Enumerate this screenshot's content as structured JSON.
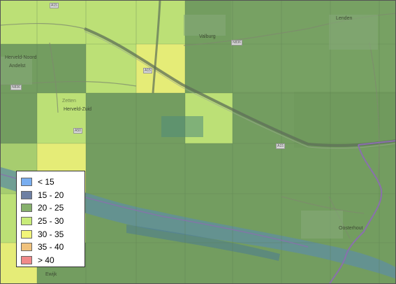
{
  "colors": {
    "base": "#6f9a5c",
    "cell_25_30": "#c9ec7a",
    "cell_30_35": "#f2f57a",
    "river": "#5f8fa0",
    "border": "#8a6fae"
  },
  "places": [
    {
      "name": "Valburg"
    },
    {
      "name": "Herveld-Noord"
    },
    {
      "name": "Andelst"
    },
    {
      "name": "Herveld-Zuid"
    },
    {
      "name": "Zetten"
    },
    {
      "name": "Oosterhout"
    },
    {
      "name": "Lenden"
    },
    {
      "name": "Ewijk"
    }
  ],
  "roads": [
    "A15",
    "A15",
    "A15",
    "A50",
    "N836",
    "N836"
  ],
  "legend": {
    "items": [
      {
        "label": "< 15",
        "color": "#79aef0"
      },
      {
        "label": "15 - 20",
        "color": "#6d7fa3"
      },
      {
        "label": "20 - 25",
        "color": "#86b06c"
      },
      {
        "label": "25 - 30",
        "color": "#c9ec7a"
      },
      {
        "label": "30 - 35",
        "color": "#f2f57a"
      },
      {
        "label": "35 - 40",
        "color": "#f0c27d"
      },
      {
        "label": "> 40",
        "color": "#f08a8a"
      }
    ]
  }
}
